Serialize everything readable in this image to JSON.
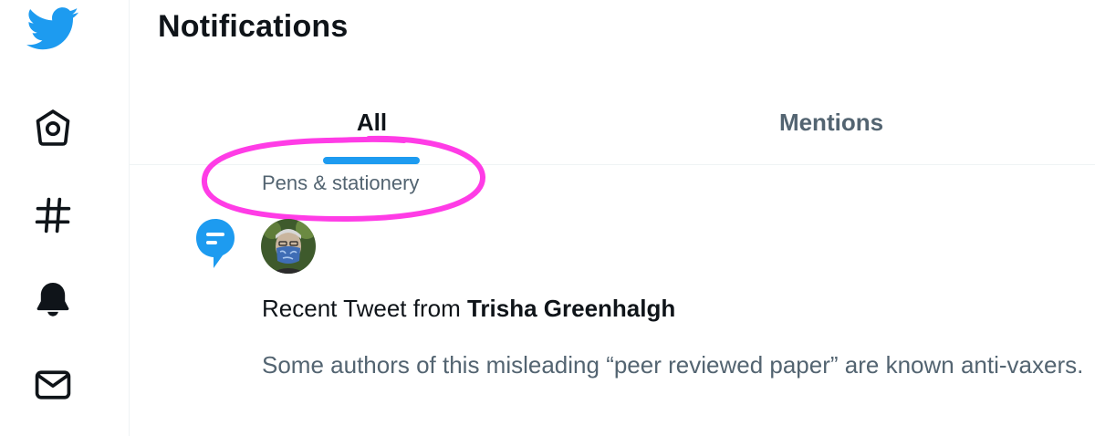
{
  "icons": {
    "logo": "twitter-bird-icon",
    "home": "home-icon",
    "explore": "hashtag-icon",
    "notifications": "bell-icon",
    "messages": "envelope-icon",
    "notification_type": "topic-bubble-icon"
  },
  "colors": {
    "brand": "#1d9bf0",
    "highlight": "#ff3ce6",
    "secondary_text": "#536471"
  },
  "header": {
    "title": "Notifications"
  },
  "tabs": [
    {
      "label": "All",
      "active": true
    },
    {
      "label": "Mentions",
      "active": false
    }
  ],
  "notification": {
    "topic": "Pens & stationery",
    "prefix": "Recent Tweet from ",
    "author": "Trisha Greenhalgh",
    "text": "Some authors of this misleading “peer reviewed paper” are known anti-vaxers."
  }
}
